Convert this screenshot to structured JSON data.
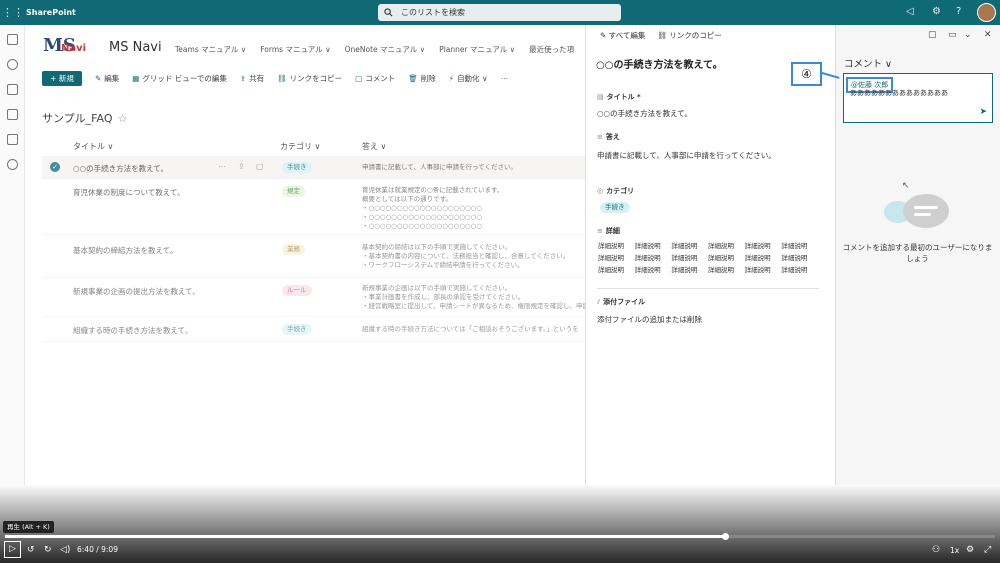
{
  "topbar": {
    "app_name": "SharePoint",
    "search_placeholder": "このリストを検索",
    "waffle_icon": "app-launcher-icon",
    "search_icon": "search-icon",
    "icons": [
      "megaphone-icon",
      "settings-icon",
      "help-icon",
      "avatar"
    ]
  },
  "site": {
    "logo_ms": "MS",
    "logo_navi": "Navi",
    "title": "MS Navi",
    "nav": [
      "Teams マニュアル ∨",
      "Forms マニュアル ∨",
      "OneNote マニュアル ∨",
      "Planner マニュアル ∨",
      "最近使った項"
    ]
  },
  "commandbar": {
    "new": "+ 新規",
    "items": [
      {
        "icon": "✎",
        "label": "編集"
      },
      {
        "icon": "▦",
        "label": "グリッド ビューでの編集"
      },
      {
        "icon": "⇪",
        "label": "共有"
      },
      {
        "icon": "⛓",
        "label": "リンクをコピー"
      },
      {
        "icon": "▢",
        "label": "コメント"
      },
      {
        "icon": "🗑",
        "label": "削除"
      },
      {
        "icon": "⚡",
        "label": "自動化 ∨"
      },
      {
        "icon": "",
        "label": "⋯"
      }
    ]
  },
  "list": {
    "title": "サンプル_FAQ",
    "star": "☆",
    "columns": {
      "title": "タイトル ∨",
      "category": "カテゴリ ∨",
      "answer": "答え ∨"
    },
    "rows": [
      {
        "title": "○○の手続き方法を教えて。",
        "tag": "手続き",
        "tag_bg": "#d8f0f1",
        "tag_fg": "#0f6a75",
        "answer": [
          "申請書に記載して、人事部に申請を行ってください。"
        ]
      },
      {
        "title": "育児休業の制度について教えて。",
        "tag": "規定",
        "tag_bg": "#dff3d6",
        "tag_fg": "#3d7a2a",
        "answer": [
          "育児休業は就業規定の○条に記載されています。",
          "概要としては以下の通りです。",
          "・○○○○○○○○○○○○○○○○○○○○",
          "・○○○○○○○○○○○○○○○○○○○○",
          "・○○○○○○○○○○○○○○○○○○○○"
        ]
      },
      {
        "title": "基本契約の締結方法を教えて。",
        "tag": "業務",
        "tag_bg": "#fbeed0",
        "tag_fg": "#8a6a1f",
        "answer": [
          "基本契約の締結は以下の手順で実施してください。",
          "・基本契約書の内容について、法務担当と確認し、合意してください。",
          "・ワークフローシステムで締結申請を行ってください。"
        ]
      },
      {
        "title": "新規事業の企画の提出方法を教えて。",
        "tag": "ルール",
        "tag_bg": "#fbd9dc",
        "tag_fg": "#a0303b",
        "answer": [
          "新規事業の企画は以下の手順で実施してください。",
          "・事業計画書を作成し、部長の承認を受けてください。",
          "・経営戦略室に提出して、申請シートが異なるため、権限規定を確認し、申請を行"
        ]
      },
      {
        "title": "組織する時の手続き方法を教えて。",
        "tag": "手続き",
        "tag_bg": "#d8f0f1",
        "tag_fg": "#0f6a75",
        "answer": [
          "組織する時の手続き方法については「ご相談おそうございます。」というを"
        ]
      }
    ]
  },
  "panel": {
    "edit_all": "✎ すべて編集",
    "copy_link": "⛓ リンクのコピー",
    "title": "○○の手続き方法を教えて。",
    "fields": {
      "title_label": "タイトル *",
      "title_value": "○○の手続き方法を教えて。",
      "answer_label": "答え",
      "answer_value": "申請書に記載して、人事部に申請を行ってください。",
      "category_label": "カテゴリ",
      "category_value": "手続き",
      "detail_label": "詳細",
      "detail_values": [
        "詳細説明",
        "詳細説明",
        "詳細説明",
        "詳細説明",
        "詳細説明",
        "詳細説明",
        "詳細説明",
        "詳細説明",
        "詳細説明",
        "詳細説明",
        "詳細説明",
        "詳細説明",
        "詳細説明",
        "詳細説明",
        "詳細説明",
        "詳細説明",
        "詳細説明",
        "詳細説明"
      ],
      "attach_label": "添付ファイル",
      "attach_value": "添付ファイルの追加または削除"
    }
  },
  "comments": {
    "title": "コメント ∨",
    "mention": "@佐藤 次郎",
    "text": "ああああああああああああああ",
    "empty": "コメントを追加する最初のユーザーになりましょう",
    "badge": "④"
  },
  "video": {
    "tooltip": "再生 (Alt + K)",
    "time": "6:40 / 9:09",
    "speed": "1x",
    "progress_fraction": 0.728
  }
}
